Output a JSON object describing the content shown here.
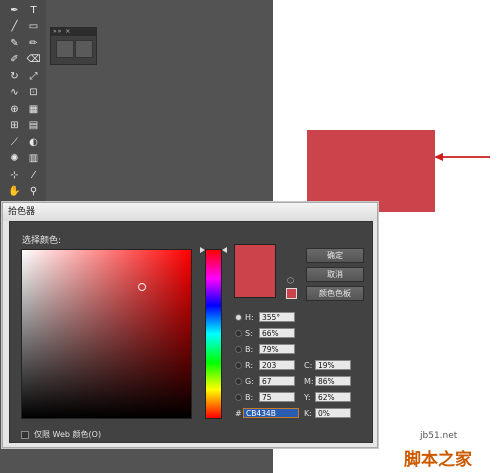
{
  "document_color": "#CB434B",
  "arrow_color": "#cc1e1e",
  "toolbar": {
    "tools": [
      {
        "icon": "pen-icon",
        "glyph": "✒"
      },
      {
        "icon": "type-icon",
        "glyph": "T"
      },
      {
        "icon": "line-icon",
        "glyph": "╱"
      },
      {
        "icon": "rectangle-icon",
        "glyph": "▭"
      },
      {
        "icon": "paintbrush-icon",
        "glyph": "✎"
      },
      {
        "icon": "pencil-icon",
        "glyph": "✏"
      },
      {
        "icon": "blob-brush-icon",
        "glyph": "✐"
      },
      {
        "icon": "eraser-icon",
        "glyph": "⌫"
      },
      {
        "icon": "rotate-icon",
        "glyph": "↻"
      },
      {
        "icon": "scale-icon",
        "glyph": "⤢"
      },
      {
        "icon": "warp-icon",
        "glyph": "∿"
      },
      {
        "icon": "free-transform-icon",
        "glyph": "⊡"
      },
      {
        "icon": "shape-builder-icon",
        "glyph": "⊕"
      },
      {
        "icon": "perspective-grid-icon",
        "glyph": "▦"
      },
      {
        "icon": "mesh-icon",
        "glyph": "⊞"
      },
      {
        "icon": "gradient-icon",
        "glyph": "▤"
      },
      {
        "icon": "eyedropper-icon",
        "glyph": "⟋"
      },
      {
        "icon": "blend-icon",
        "glyph": "◐"
      },
      {
        "icon": "symbol-sprayer-icon",
        "glyph": "✺"
      },
      {
        "icon": "column-graph-icon",
        "glyph": "▥"
      },
      {
        "icon": "artboard-icon",
        "glyph": "⊹"
      },
      {
        "icon": "slice-icon",
        "glyph": "⁄"
      },
      {
        "icon": "hand-icon",
        "glyph": "✋"
      },
      {
        "icon": "zoom-icon",
        "glyph": "⚲"
      }
    ]
  },
  "dialog": {
    "title": "拾色器",
    "select_color_label": "选择颜色:",
    "ok_button": "确定",
    "cancel_button": "取消",
    "swatches_button": "颜色色板",
    "web_only_label": "仅限 Web 颜色(O)",
    "fields": {
      "H": {
        "label": "H:",
        "value": "355°",
        "selected": true
      },
      "S": {
        "label": "S:",
        "value": "66%"
      },
      "B": {
        "label": "B:",
        "value": "79%"
      },
      "R": {
        "label": "R:",
        "value": "203"
      },
      "G": {
        "label": "G:",
        "value": "67"
      },
      "Bl": {
        "label": "B:",
        "value": "75"
      },
      "hex": {
        "label": "#",
        "value": "CB434B"
      },
      "C": {
        "label": "C:",
        "value": "19%"
      },
      "M": {
        "label": "M:",
        "value": "86%"
      },
      "Y": {
        "label": "Y:",
        "value": "62%"
      },
      "K": {
        "label": "K:",
        "value": "0%"
      }
    }
  },
  "watermark": {
    "site": "jb51.net",
    "name": "脚本之家"
  }
}
